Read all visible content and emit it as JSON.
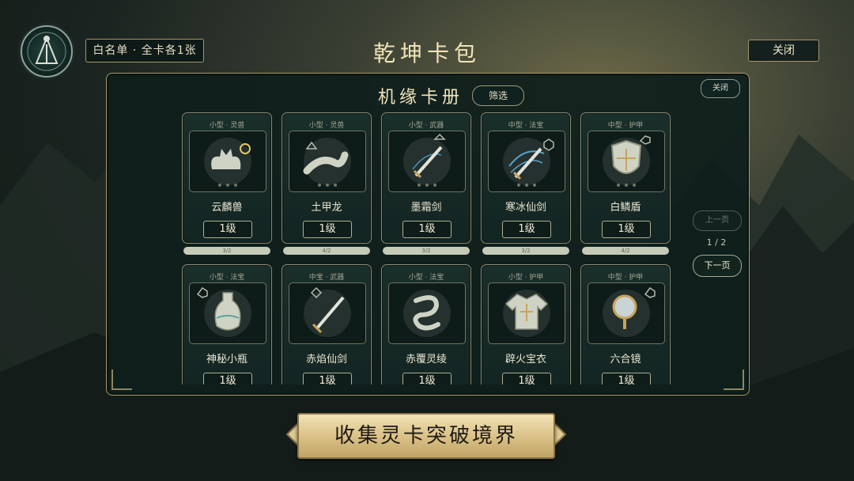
{
  "header": {
    "whitelist_label": "白名单 · 全卡各1张",
    "title": "乾坤卡包",
    "close_label": "关闭"
  },
  "panel": {
    "title": "机缘卡册",
    "filter_label": "筛选",
    "close_label": "关闭"
  },
  "pagination": {
    "prev_label": "上一页",
    "indicator": "1 / 2",
    "next_label": "下一页"
  },
  "cards_row1": [
    {
      "type": "小型 · 灵兽",
      "name": "云麟兽",
      "level": "1级",
      "progress": "3/2"
    },
    {
      "type": "小型 · 灵兽",
      "name": "土甲龙",
      "level": "1级",
      "progress": "4/2"
    },
    {
      "type": "小型 · 武器",
      "name": "墨霜剑",
      "level": "1级",
      "progress": "3/2"
    },
    {
      "type": "中型 · 法宝",
      "name": "寒冰仙剑",
      "level": "1级",
      "progress": "3/2"
    },
    {
      "type": "中型 · 护甲",
      "name": "白鳞盾",
      "level": "1级",
      "progress": "4/2"
    }
  ],
  "cards_row2": [
    {
      "type": "小型 · 法宝",
      "name": "神秘小瓶",
      "level": "1级"
    },
    {
      "type": "中宝 · 武器",
      "name": "赤焰仙剑",
      "level": "1级"
    },
    {
      "type": "小型 · 法宝",
      "name": "赤覆灵绫",
      "level": "1级"
    },
    {
      "type": "小型 · 护甲",
      "name": "辟火宝衣",
      "level": "1级"
    },
    {
      "type": "中型 · 护甲",
      "name": "六合镜",
      "level": "1级"
    }
  ],
  "banner": {
    "text": "收集灵卡突破境界"
  },
  "colors": {
    "accent_gold": "#f1e3b7",
    "panel_bg": "#0e1e1b",
    "banner_gold": "#d6bc80"
  }
}
